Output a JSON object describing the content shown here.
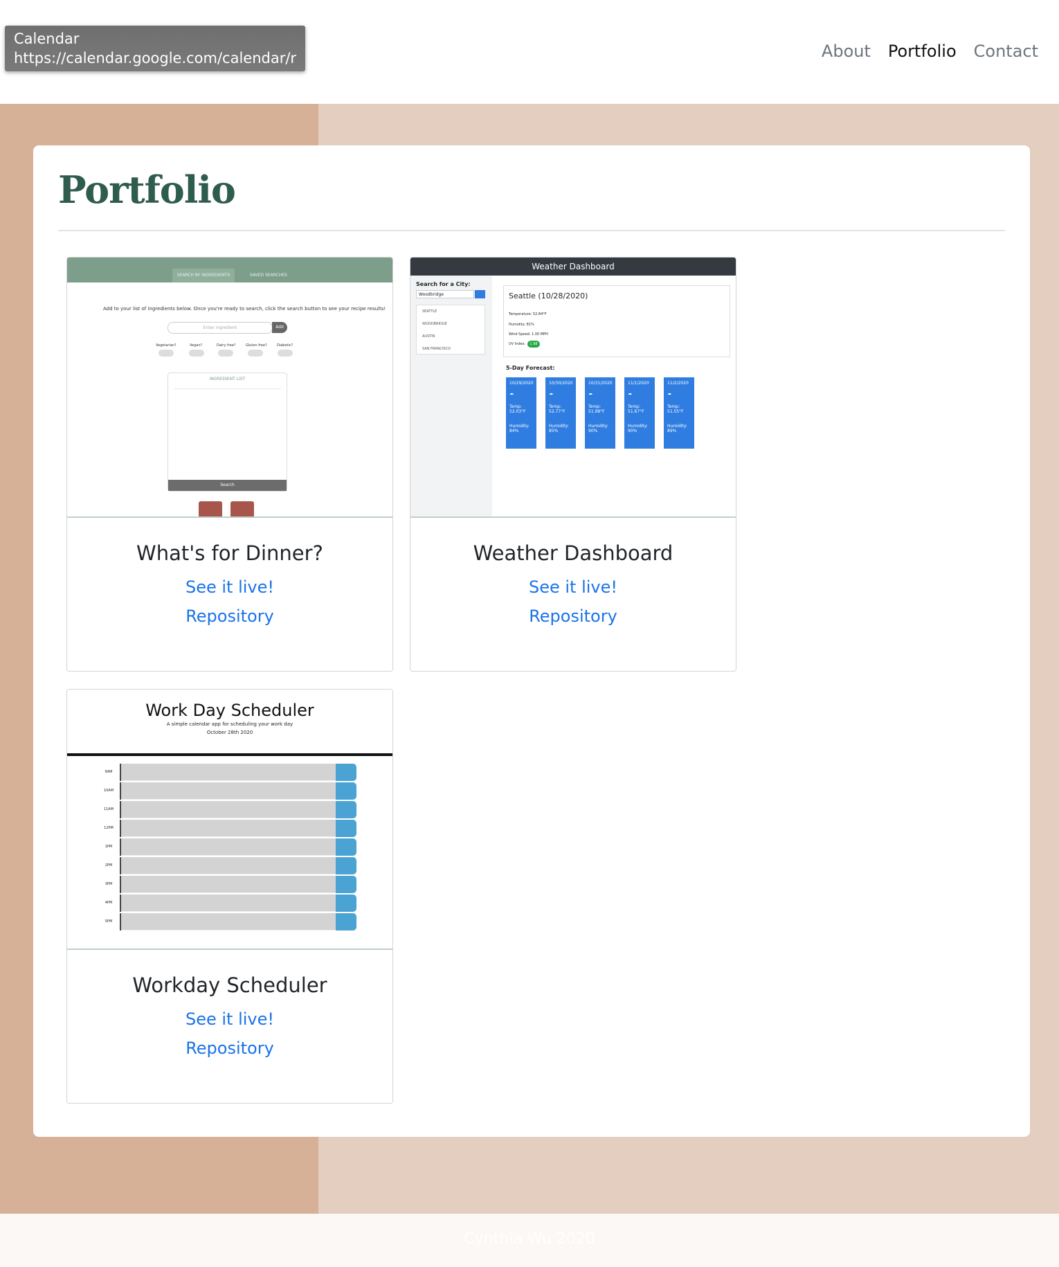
{
  "tooltip": {
    "title": "Calendar",
    "url": "https://calendar.google.com/calendar/r"
  },
  "nav": {
    "about": "About",
    "portfolio": "Portfolio",
    "contact": "Contact"
  },
  "page": {
    "title": "Portfolio"
  },
  "projects": [
    {
      "title": "What's for Dinner?",
      "live": "See it live!",
      "repo": "Repository"
    },
    {
      "title": "Weather Dashboard",
      "live": "See it live!",
      "repo": "Repository"
    },
    {
      "title": "Workday Scheduler",
      "live": "See it live!",
      "repo": "Repository"
    }
  ],
  "dinner_shot": {
    "tab1": "SEARCH BY INGREDIENTS",
    "tab2": "SAVED SEARCHES",
    "instructions": "Add to your list of ingredients below. Once you're ready to search, click the search button to see your recipe results!",
    "placeholder": "Enter ingredient",
    "add": "Add",
    "toggles": [
      "Vegetarian?",
      "Vegan?",
      "Dairy free?",
      "Gluten free?",
      "Diabetic?"
    ],
    "list_title": "INGREDIENT LIST",
    "search": "Search"
  },
  "weather_shot": {
    "header": "Weather Dashboard",
    "search_label": "Search for a City:",
    "search_value": "Woodbridge",
    "cities": [
      "SEATTLE",
      "WOODBRIDGE",
      "AUSTIN",
      "SAN FRANCISCO"
    ],
    "current": "Seattle (10/28/2020)",
    "temperature": "Temperature: 52.84°F",
    "humidity": "Humidity: 81%",
    "wind": "Wind Speed: 1.00 MPH",
    "uv_label": "UV Index:",
    "uv": "1.98",
    "forecast_title": "5-Day Forecast:",
    "forecast": [
      {
        "date": "10/29/2020",
        "temp": "Temp: 52.03°F",
        "hum": "Humidity: 84%"
      },
      {
        "date": "10/30/2020",
        "temp": "Temp: 52.77°F",
        "hum": "Humidity: 85%"
      },
      {
        "date": "10/31/2020",
        "temp": "Temp: 51.98°F",
        "hum": "Humidity: 90%"
      },
      {
        "date": "11/1/2020",
        "temp": "Temp: 51.67°F",
        "hum": "Humidity: 90%"
      },
      {
        "date": "11/2/2020",
        "temp": "Temp: 51.55°F",
        "hum": "Humidity: 89%"
      }
    ]
  },
  "scheduler_shot": {
    "title": "Work Day Scheduler",
    "subtitle": "A simple calendar app for scheduling your work day",
    "date": "October 28th 2020",
    "hours": [
      "9AM",
      "10AM",
      "11AM",
      "12PM",
      "1PM",
      "2PM",
      "3PM",
      "4PM",
      "5PM"
    ]
  },
  "footer": {
    "text": "Cynthia Wu 2020"
  },
  "colors": {
    "accent": "#2e5c4e",
    "link": "#1a73e8",
    "bg_left": "#d6b097",
    "bg_right": "#e3cebf"
  }
}
